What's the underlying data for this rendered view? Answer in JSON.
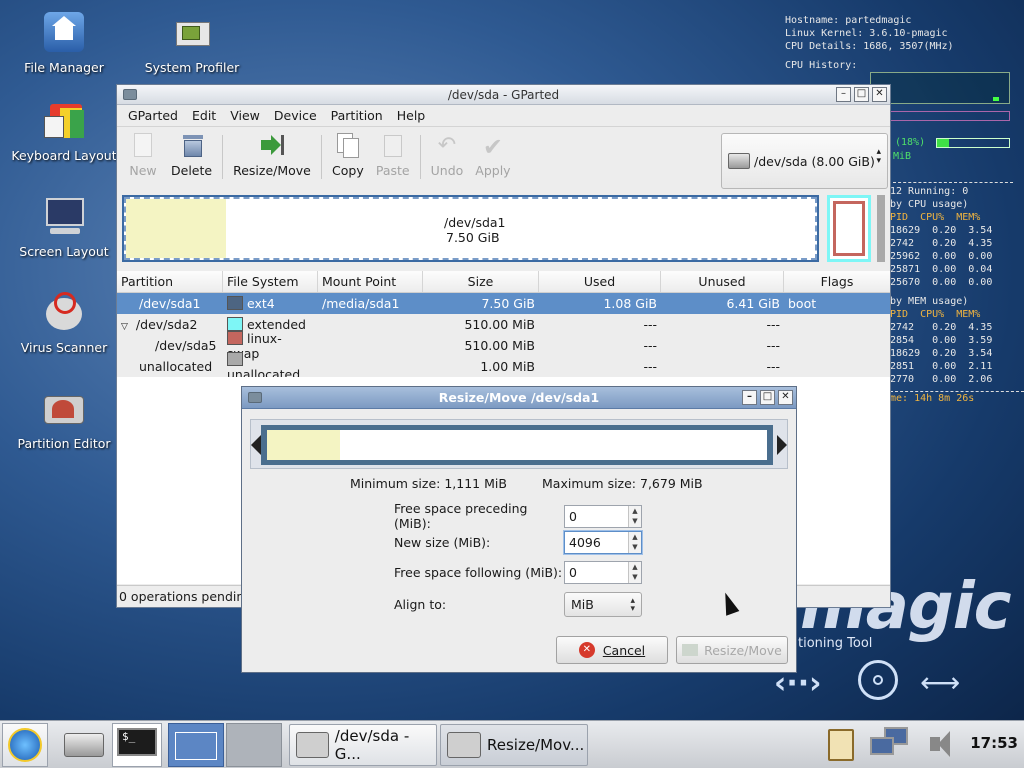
{
  "desktop": {
    "icons": [
      {
        "label": "File Manager"
      },
      {
        "label": "System Profiler"
      },
      {
        "label": "Keyboard Layout"
      },
      {
        "label": "Screen Layout"
      },
      {
        "label": "Virus Scanner"
      },
      {
        "label": "Partition Editor"
      }
    ],
    "conky": {
      "hostname": "Hostname: partedmagic",
      "kernel": "Linux Kernel: 3.6.10-pmagic",
      "cpu": "CPU Details: 1686, 3507(MHz)",
      "cpu_history": "CPU History:",
      "mem_pct": "(18%)",
      "mem_label": "MiB",
      "running": "12 Running: 0",
      "by_cpu_header": "by CPU usage)",
      "by_cpu_cols": "PID  CPU%  MEM%",
      "by_cpu_rows": [
        "18629  0.20  3.54",
        "2742   0.20  4.35",
        "25962  0.00  0.00",
        "25871  0.00  0.04",
        "25670  0.00  0.00"
      ],
      "by_mem_header": "by MEM usage)",
      "by_mem_cols": "PID  CPU%  MEM%",
      "by_mem_rows": [
        "2742   0.20  4.35",
        "2854   0.00  3.59",
        "18629  0.20  3.54",
        "2851   0.00  2.11",
        "2770   0.00  2.06"
      ],
      "uptime": "me: 14h 8m 26s"
    },
    "brand": "magic",
    "brand_sub": "tioning Tool"
  },
  "gparted": {
    "title": "/dev/sda - GParted",
    "menu": [
      "GParted",
      "Edit",
      "View",
      "Device",
      "Partition",
      "Help"
    ],
    "toolbar": {
      "new": "New",
      "delete": "Delete",
      "resize_move": "Resize/Move",
      "copy": "Copy",
      "paste": "Paste",
      "undo": "Undo",
      "apply": "Apply"
    },
    "device_combo": "/dev/sda   (8.00 GiB)",
    "graphic": {
      "name": "/dev/sda1",
      "size": "7.50 GiB"
    },
    "columns": [
      "Partition",
      "File System",
      "Mount Point",
      "Size",
      "Used",
      "Unused",
      "Flags"
    ],
    "rows": [
      {
        "partition": "/dev/sda1",
        "fs": "ext4",
        "color": "#4d6582",
        "mount": "/media/sda1",
        "size": "7.50 GiB",
        "used": "1.08 GiB",
        "unused": "6.41 GiB",
        "flags": "boot"
      },
      {
        "partition": "/dev/sda2",
        "fs": "extended",
        "color": "#7ef6f6",
        "mount": "",
        "size": "510.00 MiB",
        "used": "---",
        "unused": "---",
        "flags": ""
      },
      {
        "partition": "/dev/sda5",
        "fs": "linux-swap",
        "color": "#c4665e",
        "mount": "",
        "size": "510.00 MiB",
        "used": "---",
        "unused": "---",
        "flags": ""
      },
      {
        "partition": "unallocated",
        "fs": "unallocated",
        "color": "#a9a9a9",
        "mount": "",
        "size": "1.00 MiB",
        "used": "---",
        "unused": "---",
        "flags": ""
      }
    ],
    "status": "0 operations pending"
  },
  "dialog": {
    "title": "Resize/Move /dev/sda1",
    "min_size": "Minimum size: 1,111 MiB",
    "max_size": "Maximum size: 7,679 MiB",
    "fields": {
      "preceding_label": "Free space preceding (MiB):",
      "preceding_value": "0",
      "new_size_label": "New size (MiB):",
      "new_size_value": "4096",
      "following_label": "Free space following (MiB):",
      "following_value": "0",
      "align_label": "Align to:",
      "align_value": "MiB"
    },
    "cancel": "Cancel",
    "resize_move": "Resize/Move"
  },
  "taskbar": {
    "task1": "/dev/sda - G...",
    "task2": "Resize/Mov...",
    "clock": "17:53"
  }
}
